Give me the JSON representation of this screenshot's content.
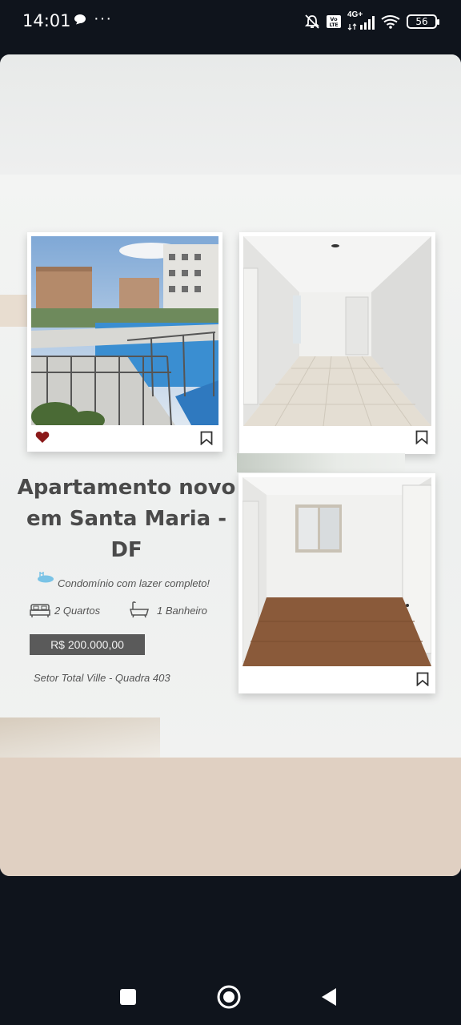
{
  "status_bar": {
    "time": "14:01",
    "network": "4G+",
    "battery": "56",
    "icons": [
      "chat-bubble-icon",
      "more-icon",
      "silent-bell-icon",
      "volte-icon",
      "signal-icon",
      "wifi-icon",
      "battery-icon"
    ]
  },
  "post": {
    "title": "Apartamento novo em Santa Maria - DF",
    "amenity": "Condomínio com lazer completo!",
    "bedrooms": "2 Quartos",
    "bathrooms": "1 Banheiro",
    "price": "R$ 200.000,00",
    "address": "Setor Total Ville - Quadra 403",
    "photos": [
      "pool-area-photo",
      "empty-hallway-photo",
      "empty-bedroom-photo"
    ],
    "favorite_color": "#8b1a1a"
  },
  "nav_bar": {
    "buttons": [
      "recent-apps-button",
      "home-button",
      "back-button"
    ]
  }
}
